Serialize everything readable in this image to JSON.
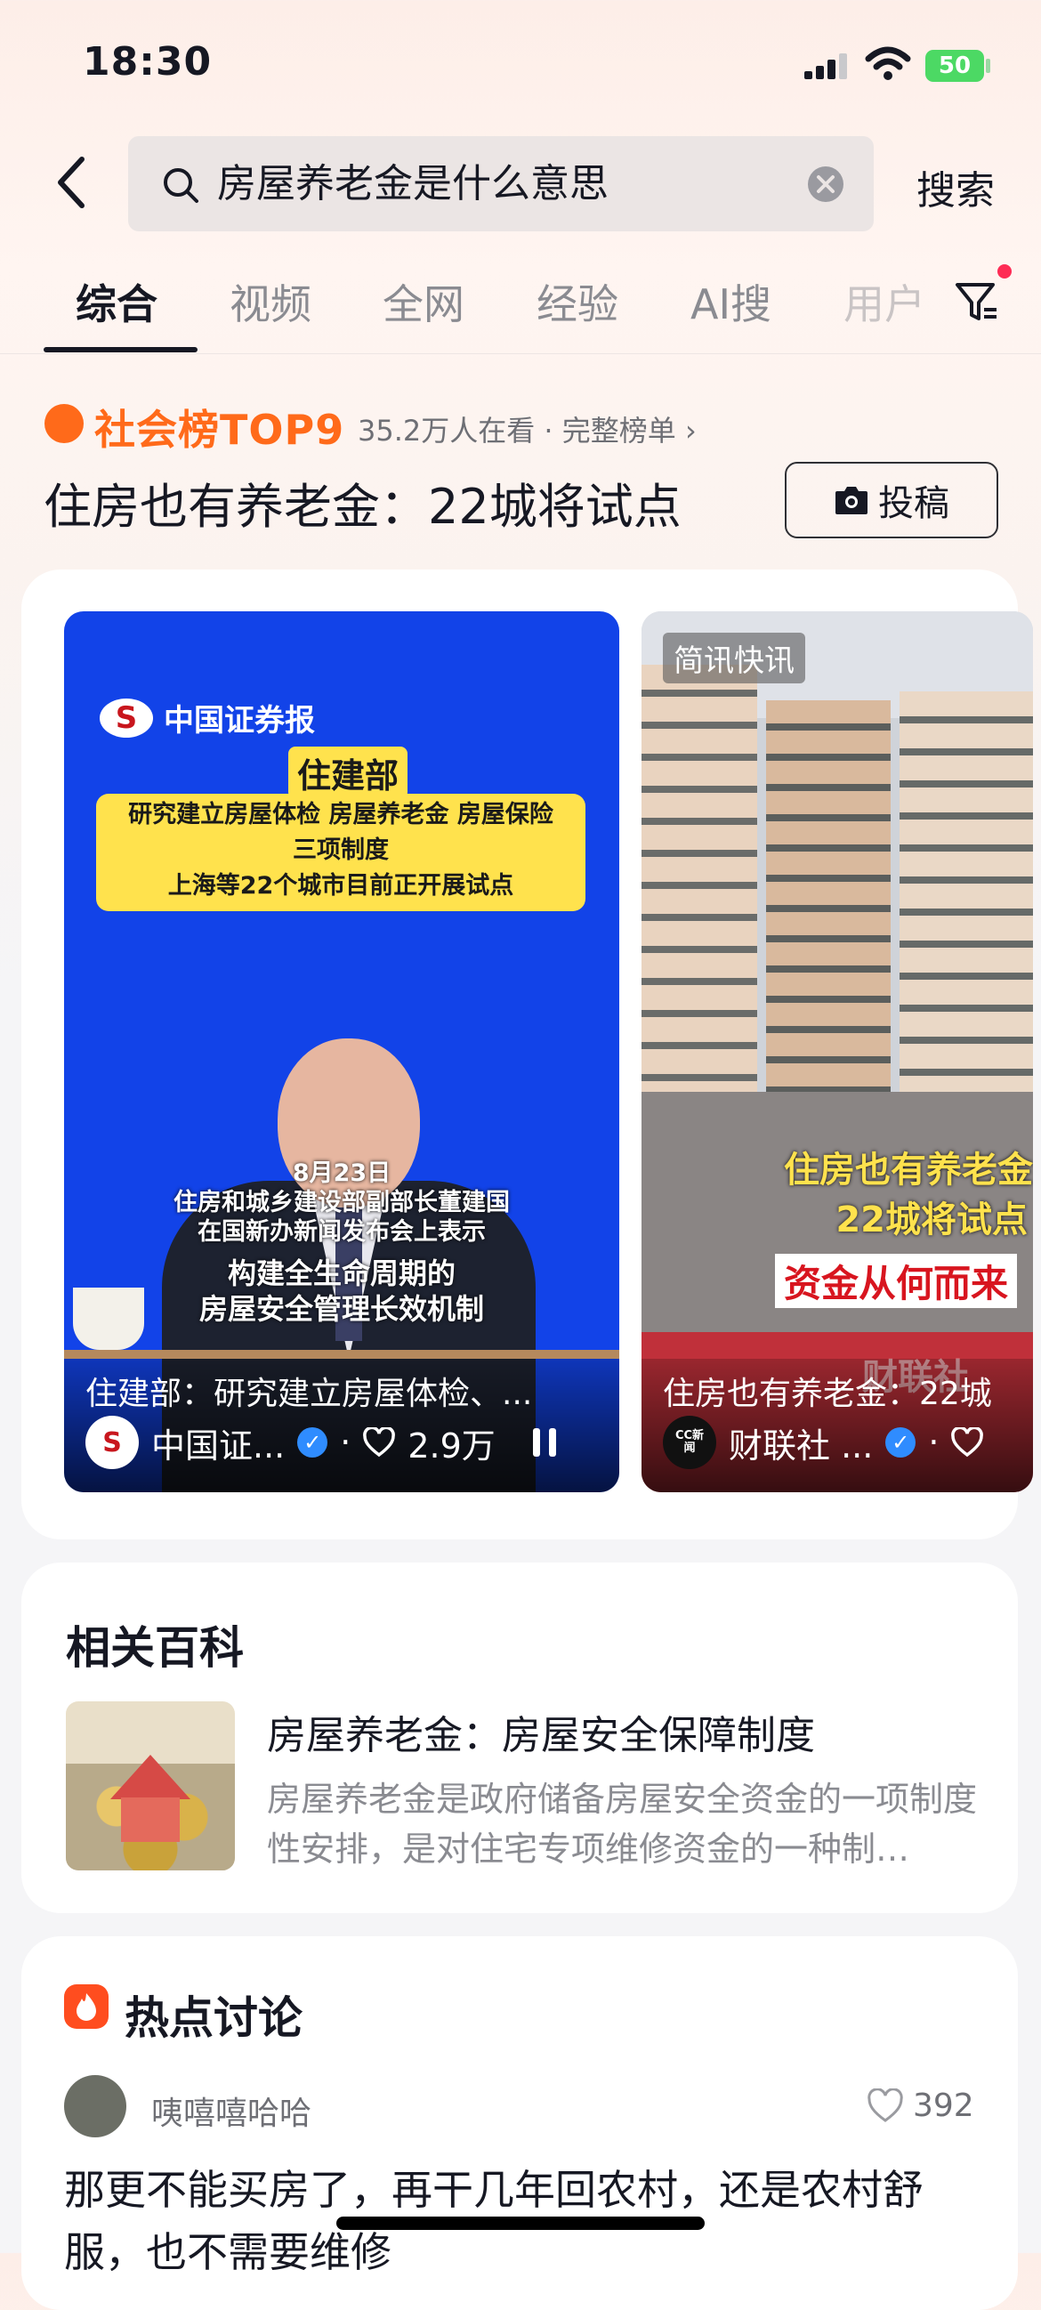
{
  "status_bar": {
    "time": "18:30",
    "battery": "50"
  },
  "search": {
    "query": "房屋养老金是什么意思",
    "button_label": "搜索"
  },
  "tabs": [
    {
      "label": "综合",
      "active": true
    },
    {
      "label": "视频",
      "active": false
    },
    {
      "label": "全网",
      "active": false
    },
    {
      "label": "经验",
      "active": false
    },
    {
      "label": "AI搜",
      "active": false
    },
    {
      "label": "用户",
      "active": false
    }
  ],
  "hot_list": {
    "badge": "社会榜TOP9",
    "meta": "35.2万人在看 · 完整榜单",
    "topic": "住房也有养老金：22城将试点",
    "submit_label": "投稿"
  },
  "videos": [
    {
      "brand": "中国证券报",
      "headline": "住建部",
      "banner_lines": [
        "研究建立房屋体检 房屋养老金 房屋保险",
        "三项制度",
        "上海等22个城市目前正开展试点"
      ],
      "overlay_lines": [
        "8月23日",
        "住房和城乡建设部副部长董建国",
        "在国新办新闻发布会上表示"
      ],
      "overlay_bold": [
        "构建全生命周期的",
        "房屋安全管理长效机制"
      ],
      "caption": "住建部：研究建立房屋体检、...",
      "author": "中国证...",
      "likes": "2.9万"
    },
    {
      "tag": "简讯快讯",
      "overlay_lines": [
        "住房也有养老金",
        "22城将试点"
      ],
      "overlay_red": "资金从何而来",
      "watermark": "财联社",
      "caption": "住房也有养老金：22城",
      "author": "财联社 ...",
      "author_avatar_text": "CC新闻"
    }
  ],
  "encyclopedia": {
    "section_title": "相关百科",
    "title": "房屋养老金：房屋安全保障制度",
    "description": "房屋养老金是政府储备房屋安全资金的一项制度性安排，是对住宅专项维修资金的一种制…"
  },
  "discussion": {
    "section_title": "热点讨论",
    "comment": {
      "user": "咦嘻嘻哈哈",
      "likes": "392",
      "text": "那更不能买房了，再干几年回农村，还是农村舒服，也不需要维修"
    }
  },
  "colors": {
    "accent_orange": "#ff6a1a",
    "video_blue": "#1243e8",
    "banner_yellow": "#ffe24d",
    "red_dot": "#fe2c55"
  },
  "icons": [
    "back-chevron-icon",
    "search-icon",
    "clear-icon",
    "filter-icon",
    "camera-icon",
    "heart-icon",
    "pause-icon",
    "verified-icon",
    "fire-icon"
  ]
}
